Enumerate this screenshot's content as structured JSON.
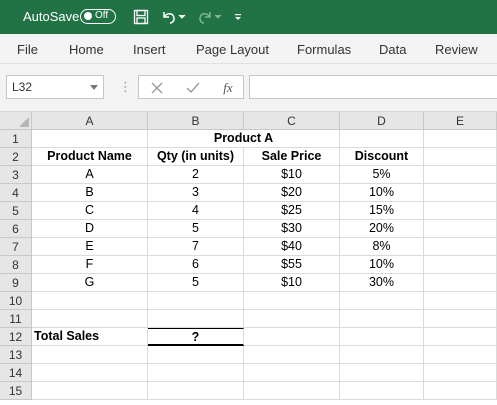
{
  "titlebar": {
    "autosave_label": "AutoSave",
    "autosave_state": "Off",
    "save_icon": "save-icon",
    "undo_icon": "undo-icon",
    "redo_icon": "redo-icon",
    "customize_icon": "customize-toolbar-icon"
  },
  "menu": [
    "File",
    "Home",
    "Insert",
    "Page Layout",
    "Formulas",
    "Data",
    "Review"
  ],
  "formula_bar": {
    "name_box": "L32",
    "fx_label": "fx",
    "formula": ""
  },
  "grid": {
    "columns": [
      "A",
      "B",
      "C",
      "D",
      "E"
    ],
    "rows": [
      "1",
      "2",
      "3",
      "4",
      "5",
      "6",
      "7",
      "8",
      "9",
      "10",
      "11",
      "12",
      "13",
      "14",
      "15"
    ],
    "merged_title": "Product A",
    "headers": [
      "Product Name",
      "Qty (in units)",
      "Sale Price",
      "Discount"
    ],
    "data": [
      [
        "A",
        "2",
        "$10",
        "5%"
      ],
      [
        "B",
        "3",
        "$20",
        "10%"
      ],
      [
        "C",
        "4",
        "$25",
        "15%"
      ],
      [
        "D",
        "5",
        "$30",
        "20%"
      ],
      [
        "E",
        "7",
        "$40",
        "8%"
      ],
      [
        "F",
        "6",
        "$55",
        "10%"
      ],
      [
        "G",
        "5",
        "$10",
        "30%"
      ]
    ],
    "total_label": "Total Sales",
    "total_value": "?"
  }
}
